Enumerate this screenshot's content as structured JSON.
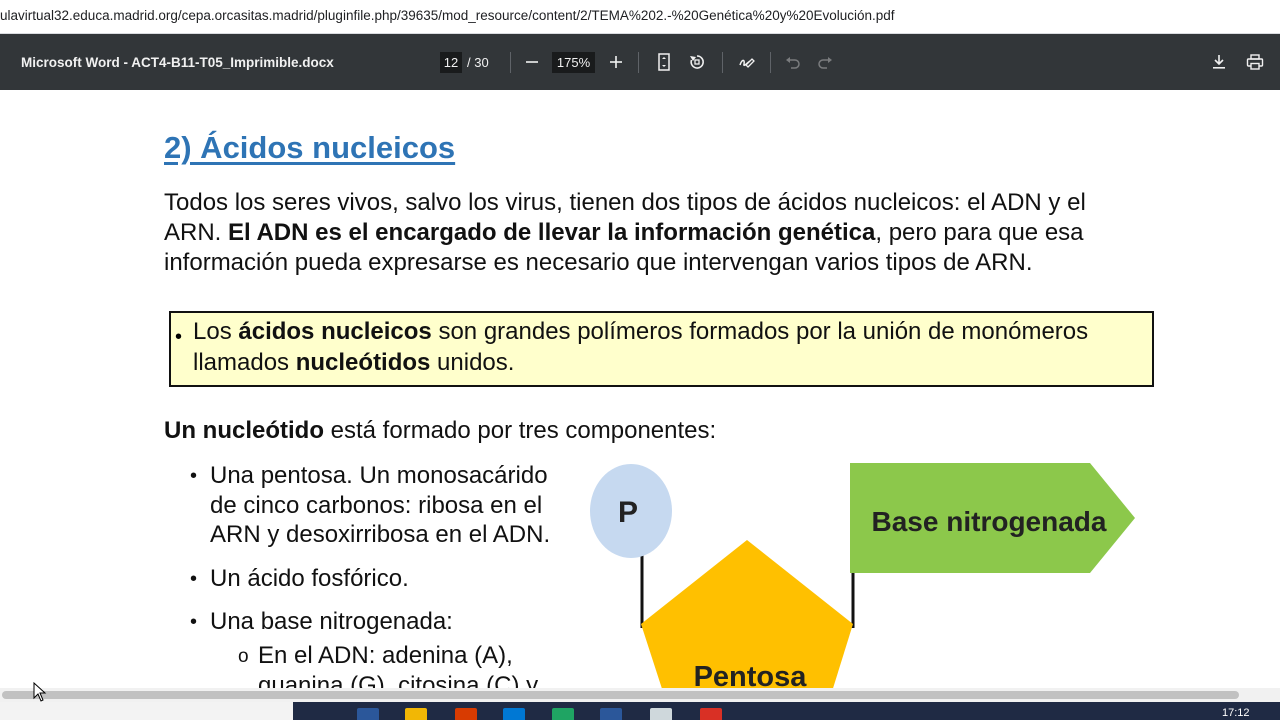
{
  "browser": {
    "url": "ulavirtual32.educa.madrid.org/cepa.orcasitas.madrid/pluginfile.php/39635/mod_resource/content/2/TEMA%202.-%20Genética%20y%20Evolución.pdf"
  },
  "viewer": {
    "doc_title": "Microsoft Word - ACT4-B11-T05_Imprimible.docx",
    "page_current": "12",
    "page_total": "/ 30",
    "zoom": "175%",
    "icons": [
      "zoom-out-icon",
      "zoom-in-icon",
      "fit-page-icon",
      "rotate-icon",
      "annotate-icon",
      "undo-icon",
      "redo-icon",
      "download-icon",
      "print-icon"
    ]
  },
  "document": {
    "heading": "2) Ácidos nucleicos",
    "intro": {
      "line1": "Todos los seres vivos, salvo los virus, tienen dos tipos de ácidos nucleicos: el ADN y el",
      "line2_a": "ARN. ",
      "line2_b": "El ADN es el encargado de llevar la información genética",
      "line2_c": ", pero para que esa",
      "line3": "información pueda expresarse es necesario que intervengan varios tipos de ARN."
    },
    "box": {
      "bullet": "•",
      "a": "Los ",
      "b": "ácidos nucleicos",
      "c": " son grandes polímeros formados por la unión de monómeros",
      "d": "llamados ",
      "e": "nucleótidos",
      "f": " unidos."
    },
    "nucleotide": {
      "title_bold": "Un nucleótido",
      "title_rest": " está formado por tres componentes:",
      "bullet": "•",
      "sub_bullet": "o",
      "item1_l1": "Una pentosa. Un monosacárido",
      "item1_l2": "de cinco carbonos: ribosa en el",
      "item1_l3": "ARN y desoxirribosa en el ADN.",
      "item2": "Un ácido fosfórico.",
      "item3": "Una base nitrogenada:",
      "sub1_l1": "En  el  ADN:  adenina  (A),",
      "sub1_l2": "guanina  (G),  citosina  (C) y"
    },
    "diagram": {
      "phosphate_label": "P",
      "base_label": "Base nitrogenada",
      "pentose_label": "Pentosa",
      "colors": {
        "phosphate": "#c6d9f0",
        "base": "#8cc84b",
        "pentose": "#ffc000"
      }
    }
  },
  "taskbar": {
    "clock": "17:12"
  }
}
